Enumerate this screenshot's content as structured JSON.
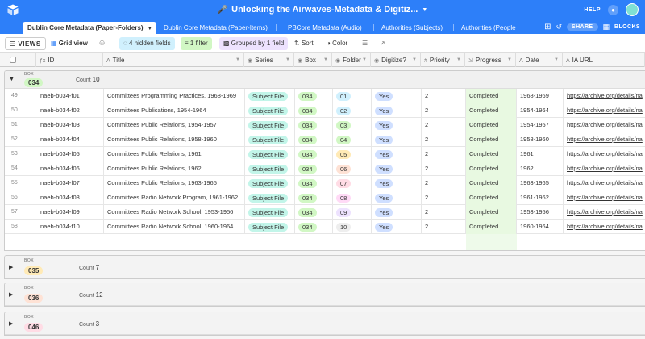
{
  "app": {
    "base_title": "Unlocking the Airwaves-Metadata & Digitiz...",
    "help": "HELP",
    "share": "SHARE",
    "blocks": "BLOCKS"
  },
  "tabs": [
    {
      "label": "Dublin Core Metadata (Paper-Folders)",
      "active": true
    },
    {
      "label": "Dublin Core Metadata (Paper-Items)"
    },
    {
      "label": "PBCore Metadata (Audio)"
    },
    {
      "label": "Authorities (Subjects)"
    },
    {
      "label": "Authorities (People"
    }
  ],
  "toolbar": {
    "views": "VIEWS",
    "view_name": "Grid view",
    "hidden_fields": "4 hidden fields",
    "filter": "1 filter",
    "grouped": "Grouped by 1 field",
    "sort": "Sort",
    "color": "Color"
  },
  "columns": [
    {
      "key": "id",
      "label": "ID",
      "icon": "formula-icon"
    },
    {
      "key": "title",
      "label": "Title",
      "icon": "text-icon"
    },
    {
      "key": "series",
      "label": "Series",
      "icon": "single-select-icon"
    },
    {
      "key": "box",
      "label": "Box",
      "icon": "single-select-icon"
    },
    {
      "key": "folder",
      "label": "Folder",
      "icon": "single-select-icon"
    },
    {
      "key": "digitize",
      "label": "Digitize?",
      "icon": "single-select-icon"
    },
    {
      "key": "priority",
      "label": "Priority",
      "icon": "number-icon"
    },
    {
      "key": "progress",
      "label": "Progress",
      "icon": "lookup-icon"
    },
    {
      "key": "date",
      "label": "Date",
      "icon": "text-icon"
    },
    {
      "key": "ia_url",
      "label": "IA URL",
      "icon": "text-icon"
    }
  ],
  "groups": [
    {
      "label": "BOX",
      "value": "034",
      "count_label": "Count",
      "count": "10",
      "expanded": true,
      "badge_color": "#d1f7c4",
      "rows": [
        {
          "num": "49",
          "id": "naeb-b034-f01",
          "title": "Committees Programming Practices, 1968-1969",
          "series": "Subject File",
          "box": "034",
          "folder": "01",
          "digitize": "Yes",
          "priority": "2",
          "progress": "Completed",
          "date": "1968-1969",
          "ia_url": "https://archive.org/details/na"
        },
        {
          "num": "50",
          "id": "naeb-b034-f02",
          "title": "Committees Publications, 1954-1964",
          "series": "Subject File",
          "box": "034",
          "folder": "02",
          "digitize": "Yes",
          "priority": "2",
          "progress": "Completed",
          "date": "1954-1964",
          "ia_url": "https://archive.org/details/na"
        },
        {
          "num": "51",
          "id": "naeb-b034-f03",
          "title": "Committees Public Relations, 1954-1957",
          "series": "Subject File",
          "box": "034",
          "folder": "03",
          "digitize": "Yes",
          "priority": "2",
          "progress": "Completed",
          "date": "1954-1957",
          "ia_url": "https://archive.org/details/na"
        },
        {
          "num": "52",
          "id": "naeb-b034-f04",
          "title": "Committees Public Relations, 1958-1960",
          "series": "Subject File",
          "box": "034",
          "folder": "04",
          "digitize": "Yes",
          "priority": "2",
          "progress": "Completed",
          "date": "1958-1960",
          "ia_url": "https://archive.org/details/na"
        },
        {
          "num": "53",
          "id": "naeb-b034-f05",
          "title": "Committees Public Relations, 1961",
          "series": "Subject File",
          "box": "034",
          "folder": "05",
          "digitize": "Yes",
          "priority": "2",
          "progress": "Completed",
          "date": "1961",
          "ia_url": "https://archive.org/details/na"
        },
        {
          "num": "54",
          "id": "naeb-b034-f06",
          "title": "Committees Public Relations, 1962",
          "series": "Subject File",
          "box": "034",
          "folder": "06",
          "digitize": "Yes",
          "priority": "2",
          "progress": "Completed",
          "date": "1962",
          "ia_url": "https://archive.org/details/na"
        },
        {
          "num": "55",
          "id": "naeb-b034-f07",
          "title": "Committees Public Relations, 1963-1965",
          "series": "Subject File",
          "box": "034",
          "folder": "07",
          "digitize": "Yes",
          "priority": "2",
          "progress": "Completed",
          "date": "1963-1965",
          "ia_url": "https://archive.org/details/na"
        },
        {
          "num": "56",
          "id": "naeb-b034-f08",
          "title": "Committees Radio Network Program, 1961-1962",
          "series": "Subject File",
          "box": "034",
          "folder": "08",
          "digitize": "Yes",
          "priority": "2",
          "progress": "Completed",
          "date": "1961-1962",
          "ia_url": "https://archive.org/details/na"
        },
        {
          "num": "57",
          "id": "naeb-b034-f09",
          "title": "Committees Radio Network School, 1953-1956",
          "series": "Subject File",
          "box": "034",
          "folder": "09",
          "digitize": "Yes",
          "priority": "2",
          "progress": "Completed",
          "date": "1953-1956",
          "ia_url": "https://archive.org/details/na"
        },
        {
          "num": "58",
          "id": "naeb-b034-f10",
          "title": "Committees Radio Network School, 1960-1964",
          "series": "Subject File",
          "box": "034",
          "folder": "10",
          "digitize": "Yes",
          "priority": "2",
          "progress": "Completed",
          "date": "1960-1964",
          "ia_url": "https://archive.org/details/na"
        }
      ]
    },
    {
      "label": "BOX",
      "value": "035",
      "count_label": "Count",
      "count": "7",
      "expanded": false,
      "badge_color": "#ffeab6",
      "rows": []
    },
    {
      "label": "BOX",
      "value": "036",
      "count_label": "Count",
      "count": "12",
      "expanded": false,
      "badge_color": "#fee2d5",
      "rows": []
    },
    {
      "label": "BOX",
      "value": "046",
      "count_label": "Count",
      "count": "3",
      "expanded": false,
      "badge_color": "#ffdce5",
      "rows": []
    }
  ],
  "colors": {
    "accent": "#2d7ff9",
    "series_pill": "#c2f5e9",
    "box_pill": "#d1f7c4",
    "digitize_pill": "#cfdfff",
    "folder_pills": [
      "#d0f0fd",
      "#d0f0fd",
      "#d1f7c4",
      "#d1f7c4",
      "#ffeab6",
      "#fee2d5",
      "#ffdce5",
      "#ffdaf6",
      "#ede2fe",
      "#eeeeee"
    ]
  }
}
